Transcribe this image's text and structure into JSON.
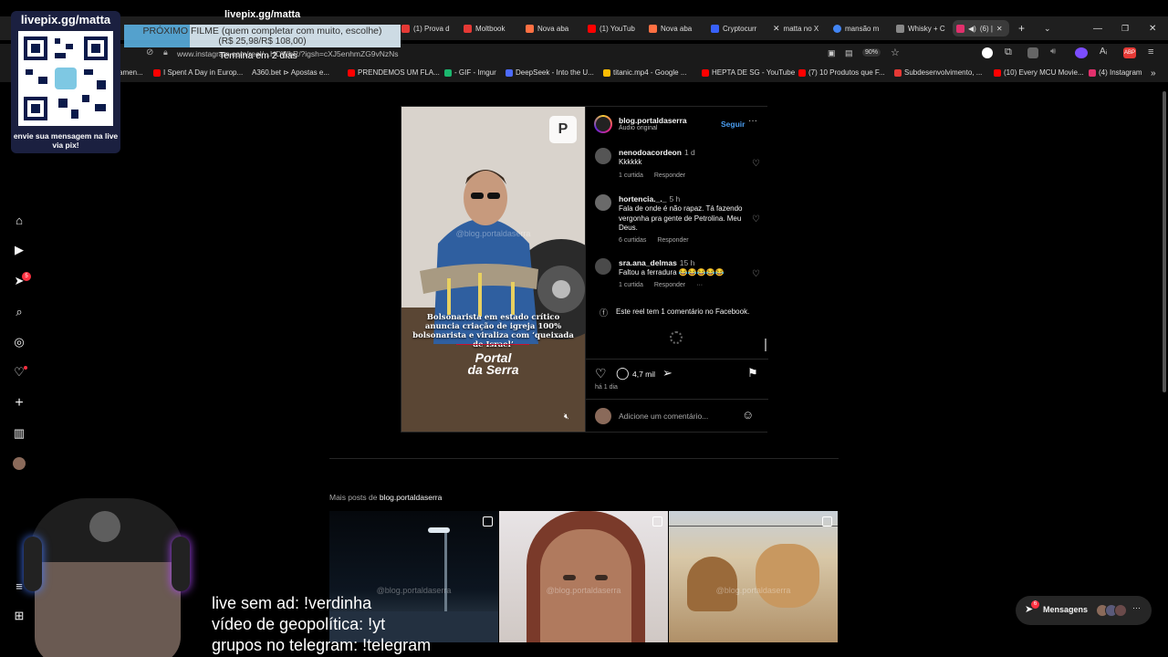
{
  "stream_overlay": {
    "header_url": "livepix.gg/matta",
    "qr_title": "livepix.gg/matta",
    "qr_caption": "envie sua mensagem na live via pix!",
    "next_movie": "PRÓXIMO FILME (quem completar com muito, escolhe)",
    "next_movie_amount": "(R$ 25,98/R$ 108,00)",
    "ends_in": "Termina em 2 dias",
    "bottom_lines": [
      "live sem ad: !verdinha",
      "vídeo de geopolítica: !yt",
      "grupos no telegram: !telegram"
    ]
  },
  "browser": {
    "tabs": [
      {
        "label": "(1) Prova d",
        "color": "#e53935"
      },
      {
        "label": "Moltbook",
        "color": "#e53935"
      },
      {
        "label": "Nova aba",
        "color": "#ff7043"
      },
      {
        "label": "(1) YouTub",
        "color": "#ff0000"
      },
      {
        "label": "Nova aba",
        "color": "#ff7043"
      },
      {
        "label": "Cryptocurr",
        "color": "#3861fb"
      },
      {
        "label": "matta no X",
        "color": "#ffffff"
      },
      {
        "label": "mansão m",
        "color": "#4285f4"
      },
      {
        "label": "Whisky + C",
        "color": "#888888"
      },
      {
        "label": "(6) |",
        "color": "#e1306c"
      }
    ],
    "url": "www.instagram.com/reel/...HDWbR/?igsh=cXJ5enhmZG9vNzNs",
    "zoom": "90%",
    "bookmarks": [
      {
        "label": "amen...",
        "color": "#e53935"
      },
      {
        "label": "I Spent A Day in Europ...",
        "color": "#ff0000"
      },
      {
        "label": "A360.bet ⊳ Apostas e...",
        "color": "#888888"
      },
      {
        "label": "PRENDEMOS UM FLA...",
        "color": "#ff0000"
      },
      {
        "label": "- GIF - Imgur",
        "color": "#1bb76e"
      },
      {
        "label": "DeepSeek - Into the U...",
        "color": "#4d6bfe"
      },
      {
        "label": "titanic.mp4 - Google ...",
        "color": "#fbbc04"
      },
      {
        "label": "HEPTA DE SG - YouTube",
        "color": "#ff0000"
      },
      {
        "label": "(7) 10 Produtos que F...",
        "color": "#ff0000"
      },
      {
        "label": "Subdesenvolvimento, ...",
        "color": "#e53935"
      },
      {
        "label": "(10) Every MCU Movie...",
        "color": "#ff0000"
      },
      {
        "label": "(4) Instagram",
        "color": "#e1306c"
      }
    ]
  },
  "sidebar": {
    "notification_count": "5",
    "items": [
      "home-icon",
      "reels-icon",
      "messages-icon",
      "search-icon",
      "explore-icon",
      "notifications-icon",
      "create-icon",
      "dashboard-icon",
      "profile-icon",
      "menu-icon",
      "threads-icon"
    ]
  },
  "post": {
    "author": "blog.portaldaserra",
    "audio": "Áudio original",
    "follow_label": "Seguir",
    "media_headline": "Bolsonarista em estado crítico anuncia criação de igreja 100% bolsonarista e viraliza com ‘queixada de Israel’",
    "media_watermark": "@blog.portaldaserra",
    "media_logo_top": "Portal",
    "media_logo_bottom": "da Serra",
    "comments": [
      {
        "user": "nenodoacordeon",
        "time": "1 d",
        "text": "Kkkkkk",
        "likes": "1 curtida",
        "reply": "Responder"
      },
      {
        "user": "hortencia._._",
        "time": "5 h",
        "text": "Fala de onde é não rapaz. Tá fazendo vergonha pra gente de Petrolina. Meu Deus.",
        "likes": "6 curtidas",
        "reply": "Responder"
      },
      {
        "user": "sra.ana_delmas",
        "time": "15 h",
        "text": "Faltou a ferradura 😂😂😂😂😂",
        "likes": "1 curtida",
        "reply": "Responder"
      }
    ],
    "facebook_note": "Este reel tem 1 comentário no Facebook.",
    "comment_count": "4,7 mil",
    "posted_ago": "há 1 dia",
    "comment_placeholder": "Adicione um comentário..."
  },
  "more_posts": {
    "label": "Mais posts de",
    "author": "blog.portaldaserra",
    "watermark": "@blog.portaldaserra"
  },
  "messages": {
    "label": "Mensagens",
    "count": "6"
  }
}
